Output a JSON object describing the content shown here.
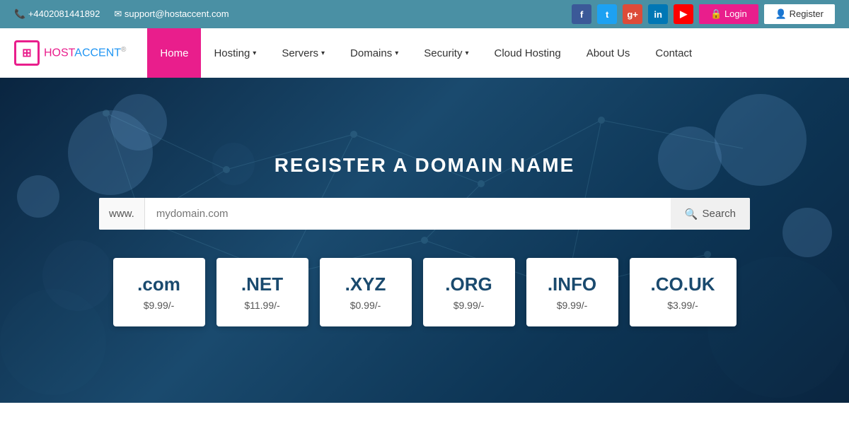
{
  "topbar": {
    "phone": "+4402081441892",
    "email": "support@hostaccent.com",
    "login_label": "Login",
    "register_label": "Register",
    "social": [
      {
        "name": "facebook",
        "class": "fb",
        "icon": "f"
      },
      {
        "name": "twitter",
        "class": "tw",
        "icon": "t"
      },
      {
        "name": "google-plus",
        "class": "gp",
        "icon": "g+"
      },
      {
        "name": "linkedin",
        "class": "li",
        "icon": "in"
      },
      {
        "name": "youtube",
        "class": "yt",
        "icon": "▶"
      }
    ]
  },
  "logo": {
    "text_host": "{",
    "icon_char": "⊞",
    "brand_host": "HOSTACCENT",
    "reg": "®",
    "close": "}"
  },
  "nav": {
    "items": [
      {
        "label": "Home",
        "active": true,
        "dropdown": false
      },
      {
        "label": "Hosting",
        "active": false,
        "dropdown": true
      },
      {
        "label": "Servers",
        "active": false,
        "dropdown": true
      },
      {
        "label": "Domains",
        "active": false,
        "dropdown": true
      },
      {
        "label": "Security",
        "active": false,
        "dropdown": true
      },
      {
        "label": "Cloud Hosting",
        "active": false,
        "dropdown": false
      },
      {
        "label": "About Us",
        "active": false,
        "dropdown": false
      },
      {
        "label": "Contact",
        "active": false,
        "dropdown": false
      }
    ]
  },
  "hero": {
    "title": "REGISTER A DOMAIN NAME",
    "search": {
      "prefix": "www.",
      "placeholder": "mydomain.com",
      "button_label": "Search"
    },
    "domains": [
      {
        "ext": ".com",
        "price": "$9.99/-"
      },
      {
        "ext": ".NET",
        "price": "$11.99/-"
      },
      {
        "ext": ".XYZ",
        "price": "$0.99/-"
      },
      {
        "ext": ".ORG",
        "price": "$9.99/-"
      },
      {
        "ext": ".INFO",
        "price": "$9.99/-"
      },
      {
        "ext": ".CO.UK",
        "price": "$3.99/-"
      }
    ]
  }
}
